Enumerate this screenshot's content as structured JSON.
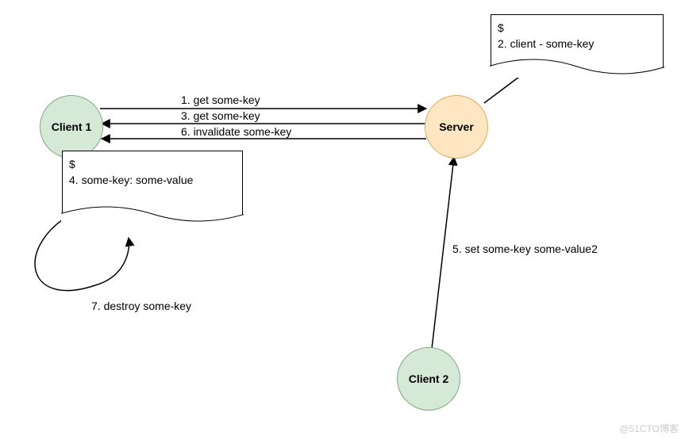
{
  "nodes": {
    "client1": "Client 1",
    "client2": "Client 2",
    "server": "Server"
  },
  "client1_note": {
    "prompt": "$",
    "line": "4. some-key: some-value"
  },
  "server_note": {
    "prompt": "$",
    "line": "2. client  -  some-key"
  },
  "messages": {
    "m1": "1. get some-key",
    "m3": "3. get some-key",
    "m6": "6. invalidate some-key",
    "m5": "5. set some-key some-value2",
    "m7": "7. destroy some-key"
  },
  "watermark": "@51CTO博客"
}
